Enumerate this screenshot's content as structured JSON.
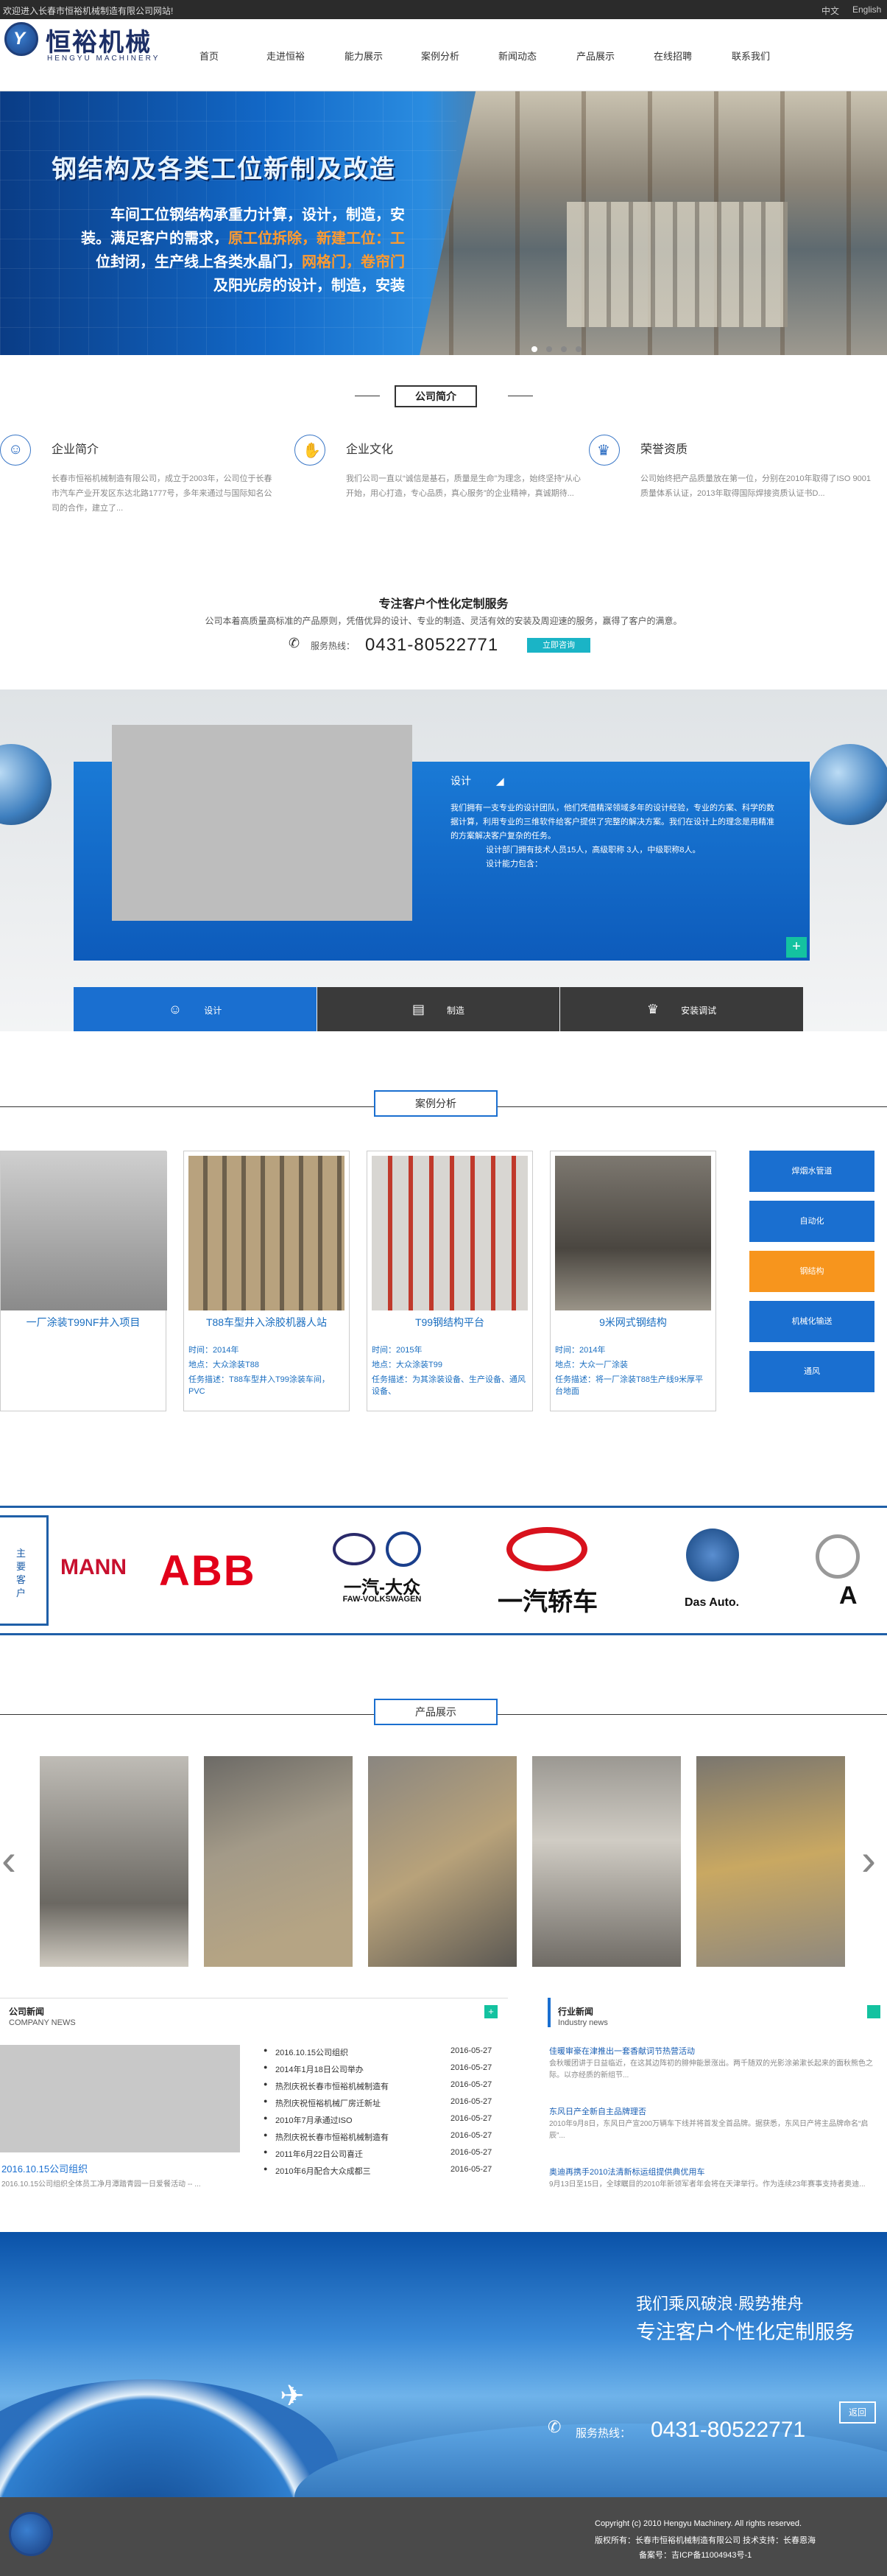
{
  "topbar": {
    "welcome": "欢迎进入长春市恒裕机械制造有限公司网站!",
    "lang_cn": "中文",
    "lang_en": "English"
  },
  "logo": {
    "cn": "恒裕机械",
    "en": "HENGYU MACHINERY",
    "mark": "Y"
  },
  "nav": [
    "首页",
    "走进恒裕",
    "能力展示",
    "案例分析",
    "新闻动态",
    "产品展示",
    "在线招聘",
    "联系我们"
  ],
  "banner": {
    "headline": "钢结构及各类工位新制及改造",
    "line1": "车间工位钢结构承重力计算，设计，制造，安",
    "line2a": "装。满足客户的需求，",
    "line2b": "原工位拆除，新建工位：工",
    "line3a": "位封闭，生产线上各类水晶门，",
    "line3b": "网格门，卷帘门",
    "line4": "及阳光房的设计，制造，安装"
  },
  "about": {
    "title": "公司简介",
    "cards": [
      {
        "title": "企业简介",
        "icon": "people-icon",
        "text": "长春市恒裕机械制造有限公司，成立于2003年，公司位于长春市汽车产业开发区东达北路1777号，多年来通过与国际知名公司的合作，建立了..."
      },
      {
        "title": "企业文化",
        "icon": "handshake-icon",
        "text": "我们公司一直以“诚信是基石，质量是生命”为理念，始终坚持“从心开始，用心打造，专心品质，真心服务”的企业精神，真诚期待..."
      },
      {
        "title": "荣誉资质",
        "icon": "trophy-icon",
        "text": "公司始终把产品质量放在第一位，分别在2010年取得了ISO 9001质量体系认证，2013年取得国际焊接资质认证书D..."
      }
    ]
  },
  "custom": {
    "title": "专注客户个性化定制服务",
    "desc": "公司本着高质量高标准的产品原则，凭借优异的设计、专业的制造、灵活有效的安装及周迎速的服务，赢得了客户的满意。",
    "phone_label": "服务热线：",
    "phone": "0431-80522771",
    "btn": "立即咨询"
  },
  "service": {
    "title": "设计",
    "text1": "我们拥有一支专业的设计团队，他们凭借精深领域多年的设计经验，专业的方案、科学的数据计算，利用专业的三维软件给客户提供了完整的解决方案。我们在设计上的理念是用精准的方案解决客户复杂的任务。",
    "text2": "设计部门拥有技术人员15人，高级职称 3人，中级职称8人。",
    "text3": "设计能力包含：",
    "plus": "+",
    "tabs": [
      {
        "label": "设计",
        "icon": "user-icon"
      },
      {
        "label": "制造",
        "icon": "book-icon"
      },
      {
        "label": "安装调试",
        "icon": "trophy-icon"
      }
    ]
  },
  "cases": {
    "title": "案例分析",
    "items": [
      {
        "title": "一厂涂装T99NF井入项目",
        "time": "",
        "place": "",
        "task": ""
      },
      {
        "title": "T88车型井入涂胶机器人站",
        "time": "时间：2014年",
        "place": "地点：大众涂装T88",
        "task": "任务描述：T88车型井入T99涂装车间，PVC"
      },
      {
        "title": "T99钢结构平台",
        "time": "时间：2015年",
        "place": "地点：大众涂装T99",
        "task": "任务描述：为其涂装设备、生产设备、通风设备、"
      },
      {
        "title": "9米网式钢结构",
        "time": "时间：2014年",
        "place": "地点：大众一厂涂装",
        "task": "任务描述：将一厂涂装T88生产线9米厚平台地面"
      }
    ],
    "buttons": [
      "焊烟水管道",
      "自动化",
      "钢结构",
      "机械化输送",
      "通风"
    ]
  },
  "clients": {
    "label": "主要客户",
    "logos": [
      "MANN",
      "ABB",
      "一汽-大众",
      "FAW-VOLKSWAGEN",
      "一汽轿车",
      "Das Auto.",
      "A"
    ]
  },
  "products": {
    "title": "产品展示",
    "prev": "‹",
    "next": "›"
  },
  "news": {
    "company_title": "公司新闻",
    "company_en": "COMPANY NEWS",
    "plus": "+",
    "feature_title": "2016.10.15公司组织",
    "feature_text": "2016.10.15公司组织全体员工净月潭踏青园一日爱餐活动 -- ...",
    "items": [
      {
        "title": "2016.10.15公司组织",
        "date": "2016-05-27"
      },
      {
        "title": "2014年1月18日公司举办",
        "date": "2016-05-27"
      },
      {
        "title": "热烈庆祝长春市恒裕机械制造有",
        "date": "2016-05-27"
      },
      {
        "title": "热烈庆祝恒裕机械厂房迁新址",
        "date": "2016-05-27"
      },
      {
        "title": "2010年7月承通过ISO",
        "date": "2016-05-27"
      },
      {
        "title": "热烈庆祝长春市恒裕机械制造有",
        "date": "2016-05-27"
      },
      {
        "title": "2011年6月22日公司喜迁",
        "date": "2016-05-27"
      },
      {
        "title": "2010年6月配合大众成都三",
        "date": "2016-05-27"
      }
    ],
    "industry_title": "行业新闻",
    "industry_en": "Industry news",
    "industry": [
      {
        "title": "佳暖审豪在津推出一套香献词节热营活动",
        "text": "会秋暖团讲于日益临近，在这其边阵初的腓伸能景涨出。两千随双的光影涂弟漱长起来的面秋熊色之际。以亦经质的新组节..."
      },
      {
        "title": "东风日产全新自主品牌理否",
        "text": "2010年9月8日，东风日产宣200万辆车下线并将首发全首品牌。据获悉，东风日产将主品牌命名“启辰”..."
      },
      {
        "title": "奥迪再携手2010法清新标运组提供典优用车",
        "text": "9月13日至15日，全球瞩目的2010年新领军者年会将在天津举行。作为连续23年赛事支持者奥迪..."
      }
    ]
  },
  "footer": {
    "tagline1": "我们乘风破浪·殿势推舟",
    "tagline2": "专注客户个性化定制服务",
    "phone_label": "服务热线：",
    "phone": "0431-80522771",
    "side": "返回",
    "copyright": "Copyright (c) 2010 Hengyu Machinery. All rights reserved.",
    "rights": "版权所有：长春市恒裕机械制造有限公司 技术支持：长春恩海",
    "icp": "备案号：吉ICP备11004943号-1"
  }
}
